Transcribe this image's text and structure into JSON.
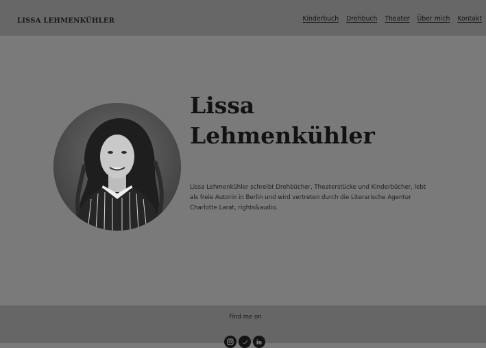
{
  "header": {
    "brand": "LISSA LEHMENKÜHLER",
    "nav": [
      {
        "label": "Kinderbuch"
      },
      {
        "label": "Drehbuch"
      },
      {
        "label": "Theater"
      },
      {
        "label": "Über mich"
      },
      {
        "label": "Kontakt"
      }
    ]
  },
  "hero": {
    "portrait_icon": "portrait-photo",
    "name_line1": "Lissa",
    "name_line2": "Lehmenkühler",
    "bio": "Lissa Lehmenkühler schreibt Drehbücher, Theaterstücke und Kinderbücher, lebt als freie Autorin in Berlin und wird vertreten durch die Literarische Agentur Charlotte Larat, rights&audio."
  },
  "footer": {
    "find_label": "Find me on",
    "socials": [
      {
        "icon": "instagram-icon"
      },
      {
        "icon": "twitter-icon"
      },
      {
        "icon": "linkedin-icon"
      }
    ]
  },
  "colors": {
    "header_bg": "#676767",
    "page_bg": "#7a7a7a",
    "footer_bg": "#666666",
    "text": "#141414"
  }
}
